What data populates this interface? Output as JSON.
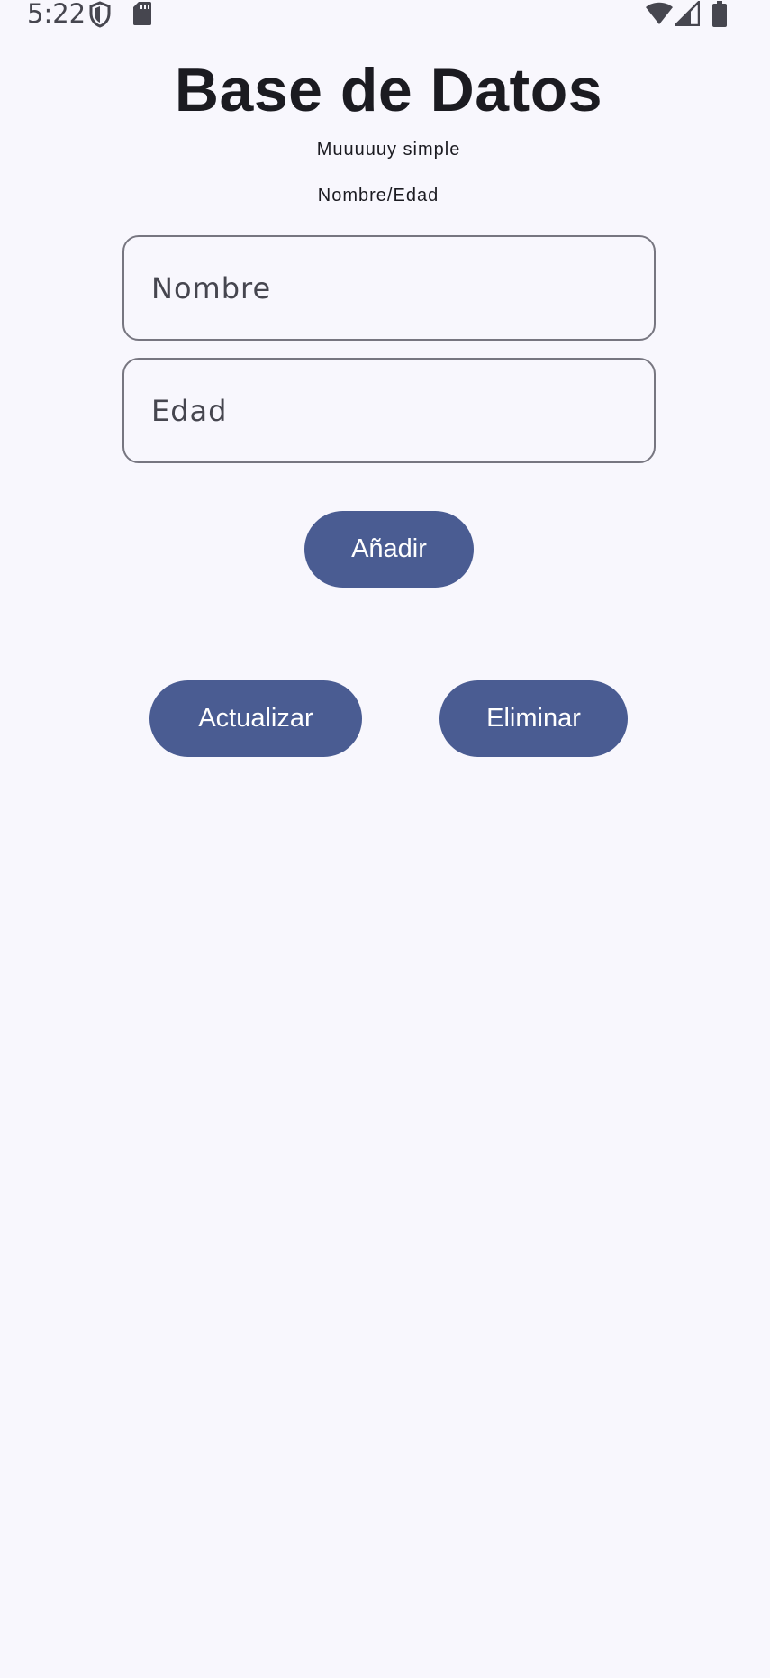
{
  "status_bar": {
    "time": "5:22",
    "icons": [
      "shield-icon",
      "sd-card-icon",
      "wifi-icon",
      "cell-signal-icon",
      "battery-icon"
    ]
  },
  "header": {
    "title": "Base de Datos",
    "subtitle": "Muuuuuy simple",
    "hint": "Nombre/Edad"
  },
  "form": {
    "name_placeholder": "Nombre",
    "name_value": "",
    "age_placeholder": "Edad",
    "age_value": ""
  },
  "actions": {
    "add_label": "Añadir",
    "update_label": "Actualizar",
    "delete_label": "Eliminar"
  },
  "colors": {
    "background": "#f8f7fd",
    "button": "#4a5c92",
    "button_text": "#ffffff",
    "field_border": "#777680",
    "text": "#1b1b21"
  }
}
